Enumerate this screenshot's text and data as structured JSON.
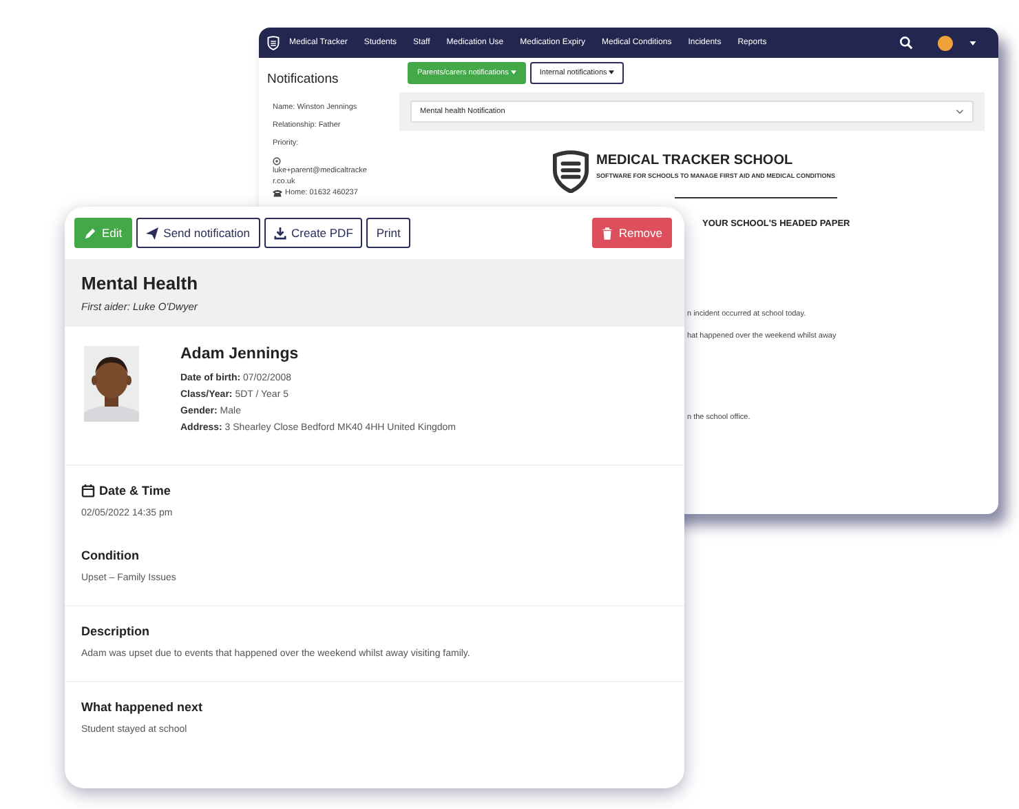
{
  "back_window": {
    "navbar": {
      "brand": "Medical Tracker",
      "items": [
        "Students",
        "Staff",
        "Medication Use",
        "Medication Expiry",
        "Medical Conditions",
        "Incidents",
        "Reports"
      ]
    },
    "sidebar": {
      "title": "Notifications",
      "lines": [
        {
          "kind": "text",
          "text": "Name: Winston Jennings"
        },
        {
          "kind": "text",
          "text": "Relationship: Father"
        },
        {
          "kind": "text",
          "text": "Priority:"
        },
        {
          "kind": "email",
          "text": "luke+parent@medicaltracker.co.uk"
        },
        {
          "kind": "phone",
          "text": "Home: 01632 460237"
        }
      ]
    },
    "buttons": [
      {
        "label": "Parents/carers notifications",
        "kind": "primary"
      },
      {
        "label": "Internal notifications",
        "kind": "outline"
      }
    ],
    "template_select": {
      "value": "Mental health Notification"
    },
    "letter": {
      "school": "MEDICAL TRACKER SCHOOL",
      "tagline": "SOFTWARE FOR SCHOOLS TO MANAGE FIRST AID AND MEDICAL CONDITIONS",
      "headed_paper": "YOUR SCHOOL'S HEADED PAPER",
      "lines": [
        "n incident occurred at school today.",
        "hat happened over the weekend whilst away",
        "n the school office."
      ]
    }
  },
  "incident": {
    "toolbar": [
      {
        "label": "Edit",
        "kind": "success"
      },
      {
        "label": "Send notification",
        "kind": "outline"
      },
      {
        "label": "Create PDF",
        "kind": "outline"
      },
      {
        "label": "Print",
        "kind": "outline"
      },
      {
        "label": "Remove",
        "kind": "danger"
      }
    ],
    "title": "Mental Health",
    "first_aider": "First aider: Luke O'Dwyer",
    "student": {
      "name": "Adam Jennings",
      "photo": {
        "kind": "picture"
      },
      "details": [
        "**Date of birth:** 07/02/2008",
        "**Class/Year:** 5DT / Year 5",
        "**Gender:** Male",
        "**Address:** 3 Shearley Close Bedford MK40 4HH United Kingdom"
      ]
    },
    "sections": [
      {
        "heading": "Date & Time",
        "value": "02/05/2022 14:35 pm"
      },
      {
        "heading": "Condition",
        "value": "Upset – Family Issues"
      },
      {
        "heading": "Description",
        "value": "Adam was upset due to events that happened over the weekend whilst away visiting family."
      },
      {
        "heading": "What happened next",
        "value": "Student stayed at school"
      }
    ]
  }
}
